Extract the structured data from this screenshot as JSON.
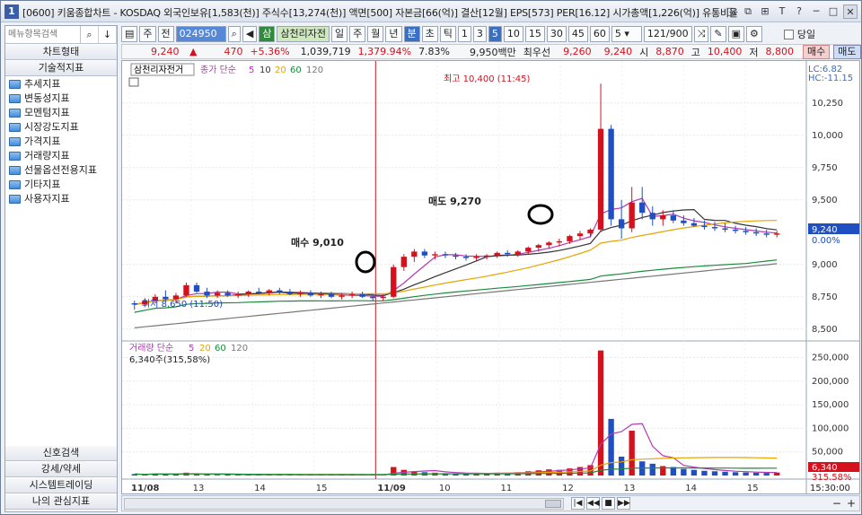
{
  "window": {
    "app_num": "1",
    "title": "[0600] 키움종합차트 - KOSDAQ 외국인보유[1,583(천)] 주식수[13,274(천)] 액면[500] 자본금[66(억)] 결산[12월] EPS[573] PER[16.12] 시가총액[1,226(억)] 유통비율",
    "controls": [
      "◫",
      "⧉",
      "⊞",
      "T",
      "?",
      "─",
      "□",
      "✕"
    ]
  },
  "left_panel": {
    "search_placeholder": "메뉴항목검색",
    "search_icon": "▾",
    "find_icon": "🔍",
    "down_icon": "↓",
    "chart_type_button": "차트형태",
    "tech_indicator_button": "기술적지표",
    "tree": [
      "추세지표",
      "변동성지표",
      "모멘텀지표",
      "시장강도지표",
      "가격지표",
      "거래량지표",
      "선물옵션전용지표",
      "기타지표",
      "사용자지표"
    ],
    "bottom_buttons": [
      "신호검색",
      "강세/약세",
      "시스템트레이딩",
      "나의 관심지표"
    ]
  },
  "toolbar": {
    "period_type": "주",
    "all": "전",
    "code": "024950",
    "sam": "삼",
    "name": "삼천리자전",
    "periods": [
      "일",
      "주",
      "월",
      "년",
      "분",
      "초",
      "틱"
    ],
    "selected_period": "분",
    "intervals": [
      "1",
      "3",
      "5",
      "10",
      "15",
      "30",
      "45",
      "60"
    ],
    "selected_interval": "5",
    "interval_value": "5",
    "count": "121",
    "total": "/900",
    "today_label": "당일"
  },
  "infobar": {
    "price": "9,240",
    "arrow": "▲",
    "change": "470",
    "change_pct": "+5.36%",
    "volume": "1,039,719",
    "vol_pct": "1,379.94%",
    "turnover": "7.83%",
    "amount": "9,950백만",
    "best_bid_label": "최우선",
    "bid": "9,260",
    "ask": "9,240",
    "open_label": "시",
    "open": "8,870",
    "high_label": "고",
    "high": "10,400",
    "low_label": "저",
    "low": "8,800",
    "buy_button": "매수",
    "sell_button": "매도"
  },
  "chart": {
    "price_panel_label": "삼천리자전거",
    "ma_label": "종가 단순",
    "ma_periods": [
      "5",
      "10",
      "20",
      "60",
      "120"
    ],
    "vol_panel_label": "거래량 단순",
    "vol_ma": [
      "5",
      "20",
      "60",
      "120"
    ],
    "vol_info": "6,340주(315,58%)",
    "lc": "LC:6.82",
    "hc": "HC:-11.15",
    "current_price_tag": "9,240",
    "current_pct": "0.00%",
    "current_vol_tag": "6,340",
    "current_vol_pct": "315.58%",
    "high_annotation": "최고 10,400 (11:45)",
    "low_annotation": "최저 8,650 (11:50)",
    "buy_annotation": "매수 9,010",
    "sell_annotation": "매도 9,270",
    "price_axis": [
      "10,250",
      "10,000",
      "9,750",
      "9,500",
      "9,000",
      "8,750",
      "8,500"
    ],
    "vol_axis": [
      "250,000",
      "200,000",
      "150,000",
      "100,000",
      "50,000"
    ],
    "x_labels": [
      "11/08",
      "13",
      "14",
      "15",
      "11/09",
      "10",
      "11",
      "12",
      "13",
      "14",
      "15"
    ],
    "time_label": "15:30:00"
  },
  "chart_data": {
    "type": "candlestick",
    "price_ylim": [
      8450,
      10450
    ],
    "vol_ylim": [
      0,
      270000
    ],
    "candles": [
      [
        8700,
        8720,
        8650,
        8690
      ],
      [
        8690,
        8740,
        8670,
        8720
      ],
      [
        8720,
        8770,
        8700,
        8750
      ],
      [
        8750,
        8800,
        8720,
        8730
      ],
      [
        8730,
        8780,
        8700,
        8760
      ],
      [
        8760,
        8860,
        8750,
        8840
      ],
      [
        8840,
        8860,
        8780,
        8790
      ],
      [
        8790,
        8820,
        8740,
        8760
      ],
      [
        8760,
        8800,
        8740,
        8780
      ],
      [
        8780,
        8800,
        8750,
        8760
      ],
      [
        8760,
        8790,
        8740,
        8770
      ],
      [
        8770,
        8800,
        8750,
        8790
      ],
      [
        8790,
        8820,
        8770,
        8780
      ],
      [
        8780,
        8810,
        8760,
        8800
      ],
      [
        8800,
        8820,
        8770,
        8790
      ],
      [
        8790,
        8810,
        8760,
        8770
      ],
      [
        8770,
        8800,
        8750,
        8780
      ],
      [
        8780,
        8800,
        8750,
        8760
      ],
      [
        8760,
        8790,
        8740,
        8770
      ],
      [
        8770,
        8790,
        8740,
        8750
      ],
      [
        8750,
        8780,
        8730,
        8760
      ],
      [
        8760,
        8790,
        8740,
        8770
      ],
      [
        8770,
        8790,
        8740,
        8750
      ],
      [
        8750,
        8770,
        8720,
        8740
      ],
      [
        8740,
        8770,
        8720,
        8750
      ],
      [
        8750,
        9000,
        8740,
        8980
      ],
      [
        8980,
        9080,
        8950,
        9060
      ],
      [
        9060,
        9120,
        9020,
        9100
      ],
      [
        9100,
        9120,
        9050,
        9070
      ],
      [
        9070,
        9100,
        9040,
        9080
      ],
      [
        9080,
        9100,
        9050,
        9070
      ],
      [
        9070,
        9090,
        9040,
        9060
      ],
      [
        9060,
        9080,
        9030,
        9050
      ],
      [
        9050,
        9080,
        9030,
        9060
      ],
      [
        9060,
        9080,
        9040,
        9070
      ],
      [
        9070,
        9100,
        9050,
        9090
      ],
      [
        9090,
        9110,
        9060,
        9080
      ],
      [
        9080,
        9110,
        9060,
        9100
      ],
      [
        9100,
        9140,
        9080,
        9130
      ],
      [
        9130,
        9160,
        9100,
        9150
      ],
      [
        9150,
        9180,
        9120,
        9170
      ],
      [
        9170,
        9200,
        9140,
        9180
      ],
      [
        9180,
        9230,
        9160,
        9220
      ],
      [
        9220,
        9260,
        9190,
        9240
      ],
      [
        9240,
        9280,
        9210,
        9270
      ],
      [
        9270,
        10400,
        9250,
        10050
      ],
      [
        10050,
        10080,
        9300,
        9350
      ],
      [
        9350,
        9500,
        9200,
        9280
      ],
      [
        9280,
        9600,
        9250,
        9480
      ],
      [
        9480,
        9600,
        9350,
        9400
      ],
      [
        9400,
        9450,
        9300,
        9350
      ],
      [
        9350,
        9420,
        9300,
        9380
      ],
      [
        9380,
        9420,
        9320,
        9340
      ],
      [
        9340,
        9380,
        9300,
        9320
      ],
      [
        9320,
        9360,
        9290,
        9300
      ],
      [
        9300,
        9340,
        9270,
        9290
      ],
      [
        9290,
        9330,
        9260,
        9280
      ],
      [
        9280,
        9320,
        9250,
        9270
      ],
      [
        9270,
        9300,
        9240,
        9260
      ],
      [
        9260,
        9290,
        9230,
        9250
      ],
      [
        9250,
        9280,
        9220,
        9240
      ],
      [
        9240,
        9270,
        9210,
        9230
      ],
      [
        9230,
        9260,
        9210,
        9240
      ]
    ],
    "volumes": [
      3000,
      2000,
      4000,
      3500,
      2500,
      6000,
      3000,
      2000,
      1500,
      2000,
      1500,
      1800,
      1500,
      1200,
      1500,
      1600,
      1300,
      1200,
      1500,
      1400,
      1200,
      1300,
      1500,
      1200,
      1400,
      18000,
      12000,
      9000,
      7000,
      6000,
      5000,
      4500,
      4000,
      5000,
      4500,
      6000,
      5500,
      7000,
      9000,
      11000,
      13000,
      12000,
      15000,
      18000,
      22000,
      265000,
      120000,
      40000,
      95000,
      30000,
      25000,
      20000,
      18000,
      14000,
      12000,
      10000,
      9000,
      8000,
      7000,
      6500,
      6000,
      5500,
      6340
    ]
  }
}
